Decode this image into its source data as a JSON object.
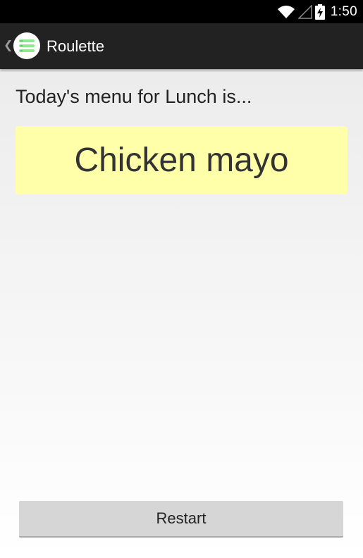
{
  "status_bar": {
    "time": "1:50",
    "icons": [
      "wifi-icon",
      "signal-icon",
      "battery-charging-icon"
    ]
  },
  "action_bar": {
    "title": "Roulette",
    "up_icon": "chevron-left-icon",
    "app_icon": "menu-list-icon"
  },
  "main": {
    "prompt": "Today's menu for Lunch is...",
    "result": "Chicken mayo",
    "result_bg": "#ffffaa"
  },
  "footer": {
    "restart_label": "Restart"
  }
}
